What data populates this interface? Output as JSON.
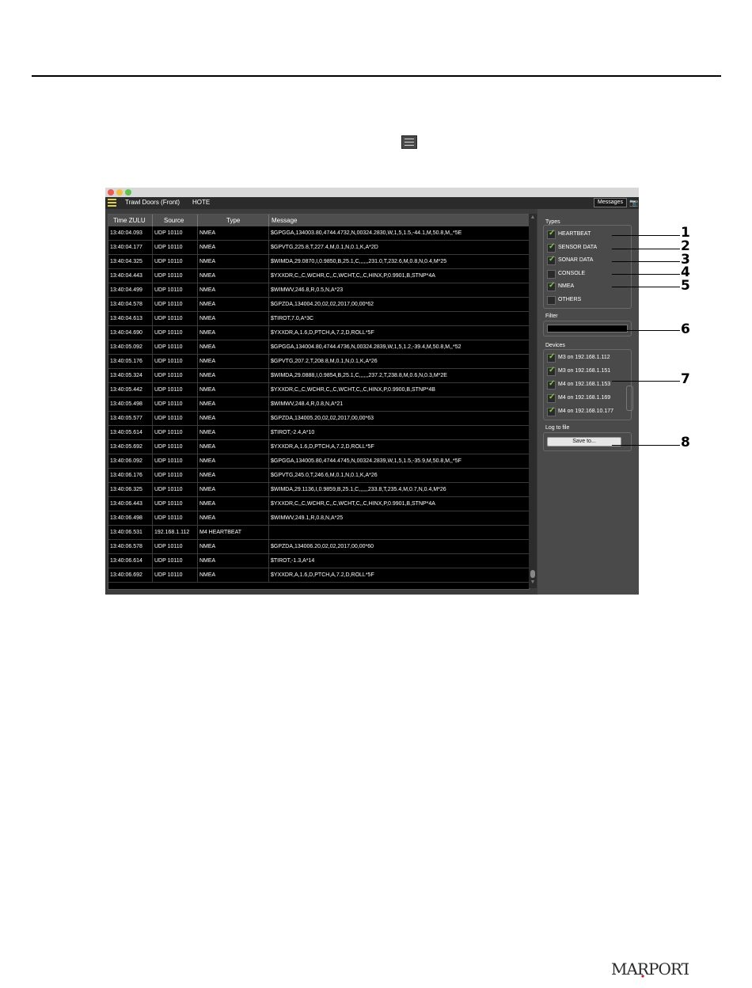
{
  "window": {
    "toolbar": {
      "device_tab": "Trawl Doors (Front)",
      "hote_tab": "HOTE",
      "messages_button": "Messages"
    },
    "table": {
      "columns": [
        "Time ZULU",
        "Source",
        "Type",
        "Message"
      ],
      "rows": [
        [
          "13:40:04.093",
          "UDP 10110",
          "NMEA",
          "$GPGGA,134003.80,4744.4732,N,00324.2830,W,1,5,1.5,-44.1,M,50.8,M,,*5E"
        ],
        [
          "13:40:04.177",
          "UDP 10110",
          "NMEA",
          "$GPVTG,225.8,T,227.4,M,0.1,N,0.1,K,A*2D"
        ],
        [
          "13:40:04.325",
          "UDP 10110",
          "NMEA",
          "$WIMDA,29.0870,I,0.9850,B,25.1,C,,,,,,231.0,T,232.6,M,0.8,N,0.4,M*25"
        ],
        [
          "13:40:04.443",
          "UDP 10110",
          "NMEA",
          "$YXXDR,C,,C,WCHR,C,,C,WCHT,C,,C,HINX,P,0.9901,B,STNP*4A"
        ],
        [
          "13:40:04.499",
          "UDP 10110",
          "NMEA",
          "$WIMWV,246.8,R,0.5,N,A*23"
        ],
        [
          "13:40:04.578",
          "UDP 10110",
          "NMEA",
          "$GPZDA,134004.20,02,02,2017,00,00*62"
        ],
        [
          "13:40:04.613",
          "UDP 10110",
          "NMEA",
          "$TIROT,7.0,A*3C"
        ],
        [
          "13:40:04.690",
          "UDP 10110",
          "NMEA",
          "$YXXDR,A,1.6,D,PTCH,A,7.2,D,ROLL*5F"
        ],
        [
          "13:40:05.092",
          "UDP 10110",
          "NMEA",
          "$GPGGA,134004.80,4744.4736,N,00324.2839,W,1,5,1.2,-39.4,M,50.8,M,,*52"
        ],
        [
          "13:40:05.176",
          "UDP 10110",
          "NMEA",
          "$GPVTG,207.2,T,208.8,M,0.1,N,0.1,K,A*26"
        ],
        [
          "13:40:05.324",
          "UDP 10110",
          "NMEA",
          "$WIMDA,29.0888,I,0.9854,B,25.1,C,,,,,,237.2,T,238.8,M,0.6,N,0.3,M*2E"
        ],
        [
          "13:40:05.442",
          "UDP 10110",
          "NMEA",
          "$YXXDR,C,,C,WCHR,C,,C,WCHT,C,,C,HINX,P,0.9900,B,STNP*4B"
        ],
        [
          "13:40:05.498",
          "UDP 10110",
          "NMEA",
          "$WIMWV,248.4,R,0.8,N,A*21"
        ],
        [
          "13:40:05.577",
          "UDP 10110",
          "NMEA",
          "$GPZDA,134005.20,02,02,2017,00,00*63"
        ],
        [
          "13:40:05.614",
          "UDP 10110",
          "NMEA",
          "$TIROT,-2.4,A*10"
        ],
        [
          "13:40:05.692",
          "UDP 10110",
          "NMEA",
          "$YXXDR,A,1.6,D,PTCH,A,7.2,D,ROLL*5F"
        ],
        [
          "13:40:06.092",
          "UDP 10110",
          "NMEA",
          "$GPGGA,134005.80,4744.4745,N,00324.2839,W,1,5,1.5,-35.9,M,50.8,M,,*5F"
        ],
        [
          "13:40:06.176",
          "UDP 10110",
          "NMEA",
          "$GPVTG,245.0,T,246.6,M,0.1,N,0.1,K,A*26"
        ],
        [
          "13:40:06.325",
          "UDP 10110",
          "NMEA",
          "$WIMDA,29.1136,I,0.9859,B,25.1,C,,,,,,233.8,T,235.4,M,0.7,N,0.4,M*26"
        ],
        [
          "13:40:06.443",
          "UDP 10110",
          "NMEA",
          "$YXXDR,C,,C,WCHR,C,,C,WCHT,C,,C,HINX,P,0.9901,B,STNP*4A"
        ],
        [
          "13:40:06.498",
          "UDP 10110",
          "NMEA",
          "$WIMWV,249.1,R,0.8,N,A*25"
        ],
        [
          "13:40:06.531",
          "192.168.1.112",
          "M4 HEARTBEAT",
          ""
        ],
        [
          "13:40:06.578",
          "UDP 10110",
          "NMEA",
          "$GPZDA,134006.20,02,02,2017,00,00*60"
        ],
        [
          "13:40:06.614",
          "UDP 10110",
          "NMEA",
          "$TIROT,-1.3,A*14"
        ],
        [
          "13:40:06.692",
          "UDP 10110",
          "NMEA",
          "$YXXDR,A,1.6,D,PTCH,A,7.2,D,ROLL*5F"
        ]
      ]
    },
    "panel": {
      "types_label": "Types",
      "types": [
        {
          "label": "HEARTBEAT",
          "checked": true
        },
        {
          "label": "SENSOR DATA",
          "checked": true
        },
        {
          "label": "SONAR DATA",
          "checked": true
        },
        {
          "label": "CONSOLE",
          "checked": false
        },
        {
          "label": "NMEA",
          "checked": true
        },
        {
          "label": "OTHERS",
          "checked": false
        }
      ],
      "filter_label": "Filter",
      "filter_value": "",
      "devices_label": "Devices",
      "devices": [
        {
          "label": "M3 on 192.168.1.112",
          "checked": true
        },
        {
          "label": "M3 on 192.168.1.151",
          "checked": true
        },
        {
          "label": "M4 on 192.168.1.153",
          "checked": true
        },
        {
          "label": "M4 on 192.168.1.169",
          "checked": true
        },
        {
          "label": "M4 on 192.168.10.177",
          "checked": true
        }
      ],
      "log_label": "Log to file",
      "save_button": "Save to..."
    }
  },
  "callouts": [
    "1",
    "2",
    "3",
    "4",
    "5",
    "6",
    "7",
    "8"
  ],
  "brand": {
    "text": "MARPORT",
    "color": "#2b2b2b",
    "dot_color": "#c8102e"
  },
  "colors": {
    "check": "#7dd23c",
    "menu_icon": "#e2d044",
    "table_bg": "#000000"
  }
}
